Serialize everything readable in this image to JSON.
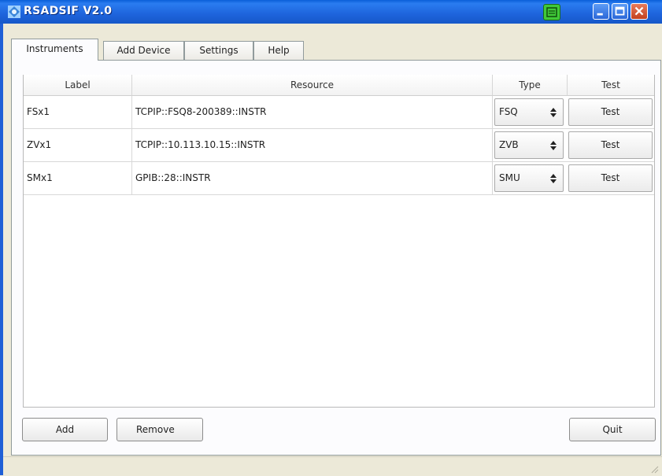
{
  "window": {
    "title": "RSADSIF V2.0",
    "icons": [
      "app-icon",
      "green-printer-icon",
      "minimize-icon",
      "maximize-icon",
      "close-icon"
    ],
    "colors": {
      "titlebar": "#1e64dc",
      "close": "#c4411e",
      "green": "#41c93a"
    }
  },
  "tabs": [
    {
      "label": "Instruments",
      "active": true
    },
    {
      "label": "Add Device",
      "active": false
    },
    {
      "label": "Settings",
      "active": false
    },
    {
      "label": "Help",
      "active": false
    }
  ],
  "table": {
    "headers": {
      "label": "Label",
      "resource": "Resource",
      "type": "Type",
      "test": "Test"
    },
    "rows": [
      {
        "label": "FSx1",
        "resource": "TCPIP::FSQ8-200389::INSTR",
        "type": "FSQ",
        "test": "Test"
      },
      {
        "label": "ZVx1",
        "resource": "TCPIP::10.113.10.15::INSTR",
        "type": "ZVB",
        "test": "Test"
      },
      {
        "label": "SMx1",
        "resource": "GPIB::28::INSTR",
        "type": "SMU",
        "test": "Test"
      }
    ]
  },
  "buttons": {
    "add": "Add",
    "remove": "Remove",
    "quit": "Quit"
  }
}
